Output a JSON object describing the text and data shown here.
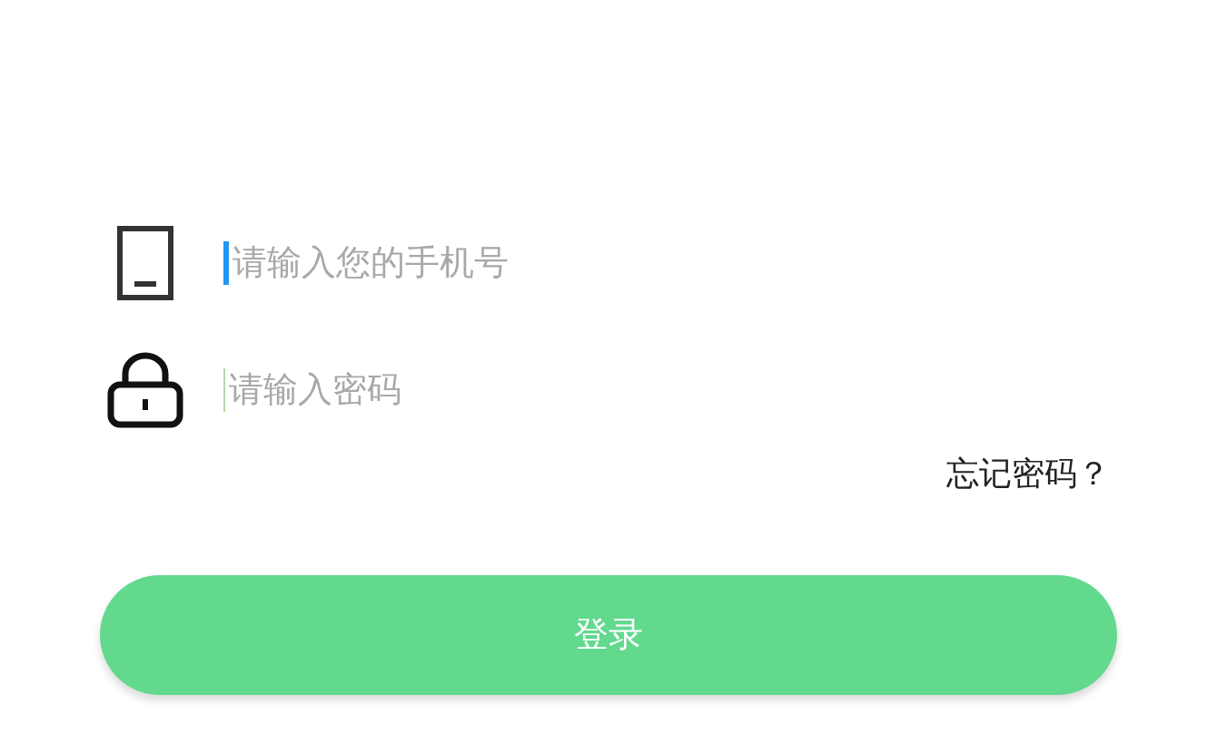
{
  "fields": [
    {
      "kind": "phone",
      "placeholder": "请输入您的手机号",
      "focused": true
    },
    {
      "kind": "password",
      "placeholder": "请输入密码",
      "focused": false
    }
  ],
  "forgot_link": "忘记密码？",
  "login_button": "登录"
}
